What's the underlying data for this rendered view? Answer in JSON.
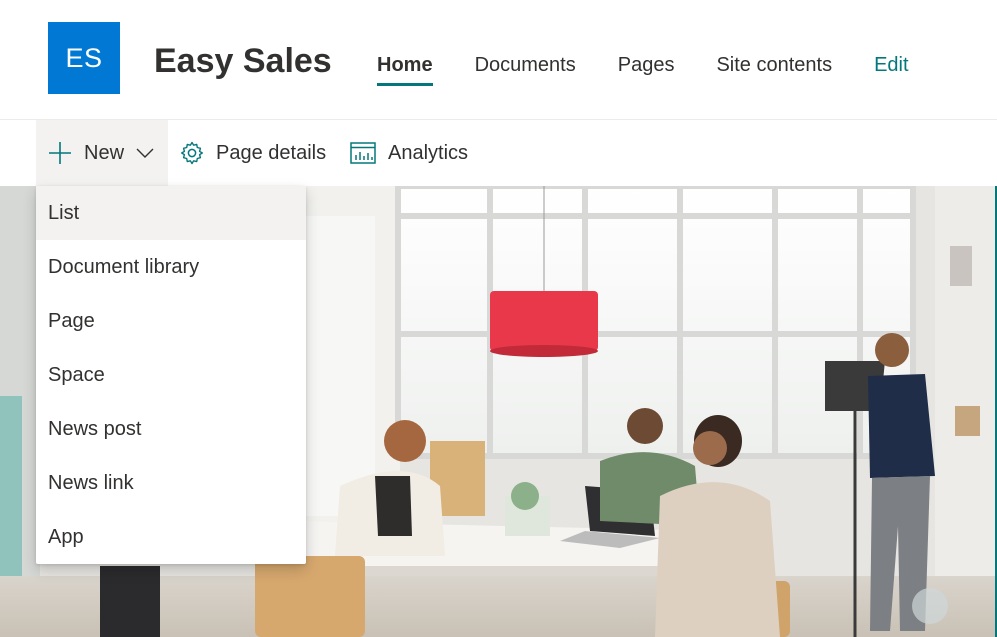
{
  "header": {
    "logo_initials": "ES",
    "site_title": "Easy Sales",
    "nav": [
      {
        "label": "Home",
        "active": true
      },
      {
        "label": "Documents"
      },
      {
        "label": "Pages"
      },
      {
        "label": "Site contents"
      },
      {
        "label": "Edit"
      }
    ]
  },
  "commandbar": {
    "new_label": "New",
    "page_details_label": "Page details",
    "analytics_label": "Analytics"
  },
  "new_menu": {
    "items": [
      "List",
      "Document library",
      "Page",
      "Space",
      "News post",
      "News link",
      "App"
    ],
    "highlighted": "List"
  },
  "colors": {
    "brand": "#0078d4",
    "accent": "#03787c",
    "text": "#323130",
    "hover": "#f3f2f1"
  },
  "icons": [
    "plus-icon",
    "chevron-down-icon",
    "gear-icon",
    "analytics-icon"
  ]
}
